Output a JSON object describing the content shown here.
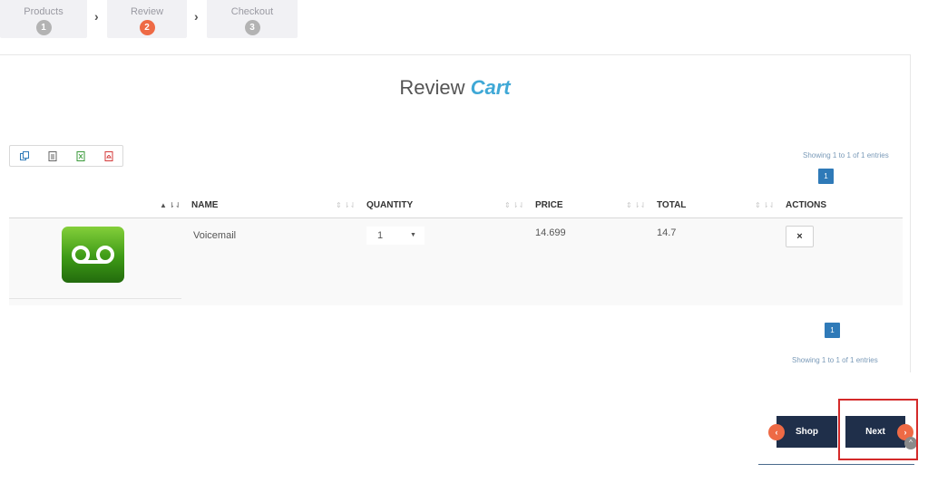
{
  "wizard": {
    "steps": [
      {
        "label": "Products",
        "number": "1"
      },
      {
        "label": "Review",
        "number": "2"
      },
      {
        "label": "Checkout",
        "number": "3"
      }
    ],
    "arrow": "›"
  },
  "page": {
    "title": "Review",
    "title_accent": "Cart"
  },
  "toolbar": {
    "icons": [
      "copy-icon",
      "csv-icon",
      "excel-icon",
      "pdf-icon"
    ]
  },
  "table": {
    "info_top": "Showing 1 to 1 of 1 entries",
    "info_bottom": "Showing 1 to 1 of 1 entries",
    "page_number": "1",
    "headers": [
      "NAME",
      "QUANTITY",
      "PRICE",
      "TOTAL",
      "ACTIONS"
    ],
    "rows": [
      {
        "name": "Voicemail",
        "quantity": "1",
        "price": "14.699",
        "total": "14.7",
        "action": "×"
      }
    ]
  },
  "nav": {
    "shop_label": "Shop",
    "next_label": "Next",
    "prev_glyph": "‹",
    "next_glyph": "›"
  },
  "colors": {
    "accent": "#3fa8d6",
    "active_step": "#ee6a45",
    "nav_button": "#1f2f4a",
    "page_button": "#2f7ab8"
  }
}
